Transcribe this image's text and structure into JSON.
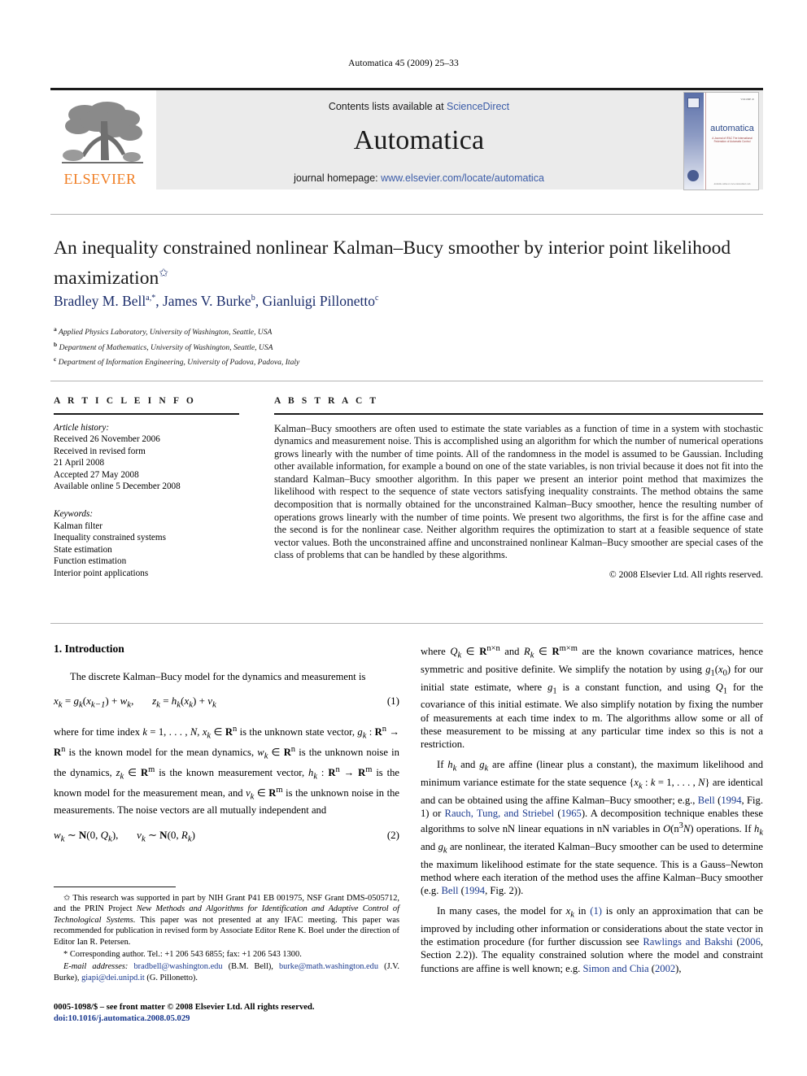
{
  "running_head": "Automatica 45 (2009) 25–33",
  "banner": {
    "publisher": "ELSEVIER",
    "contents_prefix": "Contents lists available at ",
    "contents_link": "ScienceDirect",
    "journal_name": "Automatica",
    "homepage_prefix": "journal homepage: ",
    "homepage_url": "www.elsevier.com/locate/automatica",
    "cover": {
      "title": "automatica",
      "subtitle": "A Journal of IFAC The International Federation of Automatic Control",
      "date": "VOLUME 45",
      "footer": "Available online at www.sciencedirect.com"
    }
  },
  "article": {
    "title": "An inequality constrained nonlinear Kalman–Bucy smoother by interior point likelihood maximization",
    "title_marker": "✩",
    "authors": "Bradley M. Bell, James V. Burke, Gianluigi Pillonetto",
    "author_list": [
      {
        "name": "Bradley M. Bell",
        "marks": "a,*"
      },
      {
        "name": "James V. Burke",
        "marks": "b"
      },
      {
        "name": "Gianluigi Pillonetto",
        "marks": "c"
      }
    ],
    "affiliations": [
      {
        "mark": "a",
        "text": "Applied Physics Laboratory, University of Washington, Seattle, USA"
      },
      {
        "mark": "b",
        "text": "Department of Mathematics, University of Washington, Seattle, USA"
      },
      {
        "mark": "c",
        "text": "Department of Information Engineering, University of Padova, Padova, Italy"
      }
    ]
  },
  "info": {
    "heading": "A R T I C L E    I N F O",
    "history_label": "Article history:",
    "history": [
      "Received 26 November 2006",
      "Received in revised form",
      "21 April 2008",
      "Accepted 27 May 2008",
      "Available online 5 December 2008"
    ],
    "keywords_label": "Keywords:",
    "keywords": [
      "Kalman filter",
      "Inequality constrained systems",
      "State estimation",
      "Function estimation",
      "Interior point applications"
    ]
  },
  "abstract": {
    "heading": "A B S T R A C T",
    "text": "Kalman–Bucy smoothers are often used to estimate the state variables as a function of time in a system with stochastic dynamics and measurement noise. This is accomplished using an algorithm for which the number of numerical operations grows linearly with the number of time points. All of the randomness in the model is assumed to be Gaussian. Including other available information, for example a bound on one of the state variables, is non trivial because it does not fit into the standard Kalman–Bucy smoother algorithm. In this paper we present an interior point method that maximizes the likelihood with respect to the sequence of state vectors satisfying inequality constraints. The method obtains the same decomposition that is normally obtained for the unconstrained Kalman–Bucy smoother, hence the resulting number of operations grows linearly with the number of time points. We present two algorithms, the first is for the affine case and the second is for the nonlinear case. Neither algorithm requires the optimization to start at a feasible sequence of state vector values. Both the unconstrained affine and unconstrained nonlinear Kalman–Bucy smoother are special cases of the class of problems that can be handled by these algorithms.",
    "copyright": "© 2008 Elsevier Ltd. All rights reserved."
  },
  "body": {
    "section_heading": "1.  Introduction",
    "left": {
      "p1": "The discrete Kalman–Bucy model for the dynamics and measurement is",
      "eq1_num": "(1)",
      "p2": "where for time index k = 1, . . . , N, x",
      "eq2_num": "(2)"
    },
    "right": {
      "p1_tail": "are the known covariance matrices, hence symmetric and positive definite. We simplify the notation by using",
      "p3_head": "In many cases,  the model for"
    }
  },
  "footnotes": {
    "funding": "This research was supported in part by NIH Grant P41 EB 001975, NSF Grant DMS-0505712, and the PRIN Project ",
    "funding_italic": "New Methods and Algorithms for Identification and Adaptive Control of Technological Systems",
    "funding_tail": ". This paper was not presented at any IFAC meeting. This paper was recommended for publication in revised form by Associate Editor Rene K. Boel under the direction of Editor Ian R. Petersen.",
    "corresponding": "Corresponding author. Tel.: +1 206 543 6855; fax: +1 206 543 1300.",
    "email_label": "E-mail addresses:",
    "emails": [
      {
        "address": "bradbell@washington.edu",
        "owner": "(B.M. Bell)"
      },
      {
        "address": "burke@math.washington.edu",
        "owner": "(J.V. Burke)"
      },
      {
        "address": "giapi@dei.unipd.it",
        "owner": "(G. Pillonetto)"
      }
    ]
  },
  "footer": {
    "issn": "0005-1098/$ – see front matter © 2008 Elsevier Ltd. All rights reserved.",
    "doi": "doi:10.1016/j.automatica.2008.05.029"
  },
  "colors": {
    "link_blue": "#1b3a8f",
    "author_blue": "#1b2d6b",
    "elsevier_orange": "#F07D22",
    "cite_red": "#9a2b2b",
    "banner_grey": "#ebebeb"
  }
}
